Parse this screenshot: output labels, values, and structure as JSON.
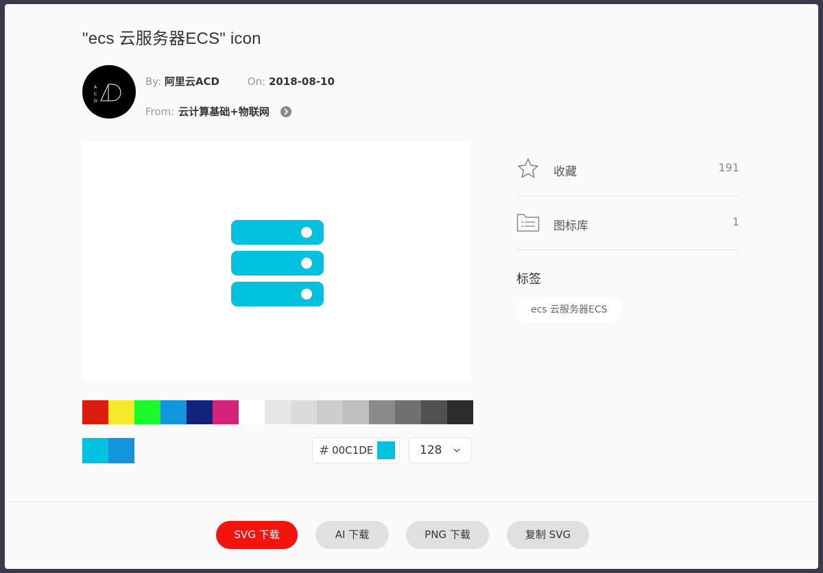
{
  "title": "\"ecs 云服务器ECS\" icon",
  "author": {
    "by_label": "By:",
    "name": "阿里云ACD",
    "on_label": "On:",
    "date": "2018-08-10",
    "from_label": "From:",
    "library": "云计算基础+物联网",
    "avatar_text": [
      "A",
      "C",
      "D"
    ]
  },
  "icon": {
    "name": "ecs 云服务器ECS",
    "color": "#00C1DE"
  },
  "palette": [
    "#DB1C0F",
    "#F4EA2A",
    "#1AFA29",
    "#1296DB",
    "#13227A",
    "#D4237A",
    "#FFFFFF",
    "#E6E6E6",
    "#DBDBDB",
    "#CDCDCD",
    "#BFBFBF",
    "#8A8A8A",
    "#707070",
    "#515151",
    "#2C2C2C"
  ],
  "current_colors": [
    "#00C1DE",
    "#1296DB"
  ],
  "color_input": {
    "hash": "#",
    "value": "00C1DE",
    "swatch": "#00C1DE"
  },
  "size_select": {
    "value": "128"
  },
  "stats": [
    {
      "label": "收藏",
      "count": "191",
      "icon": "star-icon"
    },
    {
      "label": "图标库",
      "count": "1",
      "icon": "folder-list-icon"
    }
  ],
  "tags": {
    "title": "标签",
    "items": [
      "ecs 云服务器ECS"
    ]
  },
  "buttons": {
    "svg_download": "SVG 下载",
    "ai_download": "AI 下载",
    "png_download": "PNG 下载",
    "copy_svg": "复制 SVG"
  }
}
